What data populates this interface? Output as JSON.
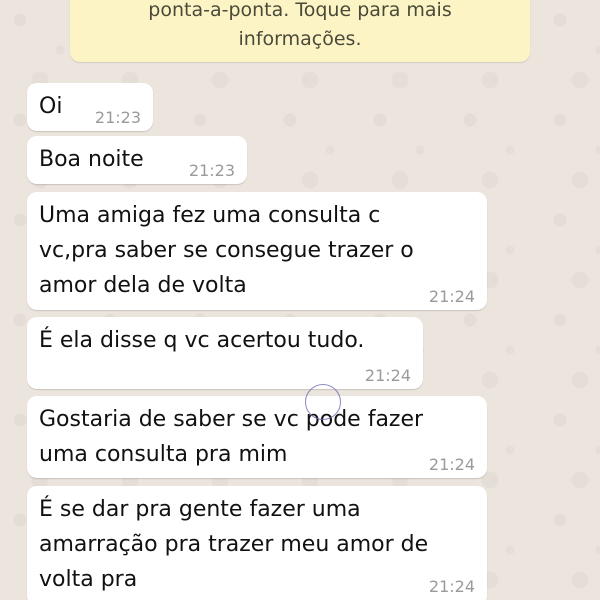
{
  "encryption_notice": {
    "line1": "ponta-a-ponta. Toque para mais",
    "line2": "informações."
  },
  "messages": [
    {
      "text": "Oi",
      "time": "21:23"
    },
    {
      "text": "Boa noite",
      "time": "21:23"
    },
    {
      "text": "Uma amiga fez uma consulta c\nvc,pra saber se consegue trazer o\namor dela de volta",
      "time": "21:24"
    },
    {
      "text": "É ela disse q vc acertou tudo.",
      "time": "21:24"
    },
    {
      "text": "Gostaria de saber se vc pode fazer\numa consulta pra mim",
      "time": "21:24"
    },
    {
      "text": "É se dar pra gente fazer uma\namarração pra trazer meu amor de\nvolta pra",
      "time": "21:24"
    }
  ],
  "colors": {
    "background": "#ece5dd",
    "notice_background": "#fdf4c5",
    "bubble_background": "#ffffff",
    "timestamp": "#9a9a9a"
  }
}
